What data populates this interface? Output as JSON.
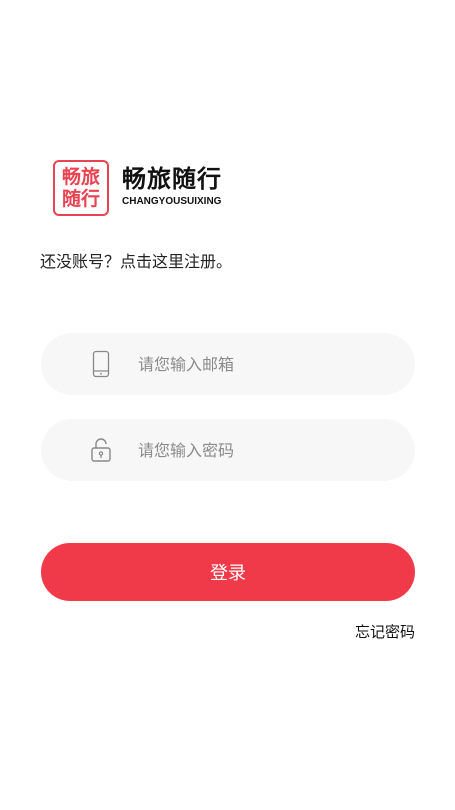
{
  "logo": {
    "line1": "畅旅",
    "line2": "随行",
    "accent_color": "#e94352"
  },
  "brand": {
    "name_cn": "畅旅随行",
    "name_en": "CHANGYOUSUIXING"
  },
  "register_prompt": "还没账号？点击这里注册。",
  "email_field": {
    "icon": "phone-icon",
    "placeholder": "请您输入邮箱",
    "value": ""
  },
  "password_field": {
    "icon": "lock-icon",
    "placeholder": "请您输入密码",
    "value": ""
  },
  "login_button": {
    "label": "登录",
    "color": "#f03a4a"
  },
  "forgot_password": "忘记密码"
}
